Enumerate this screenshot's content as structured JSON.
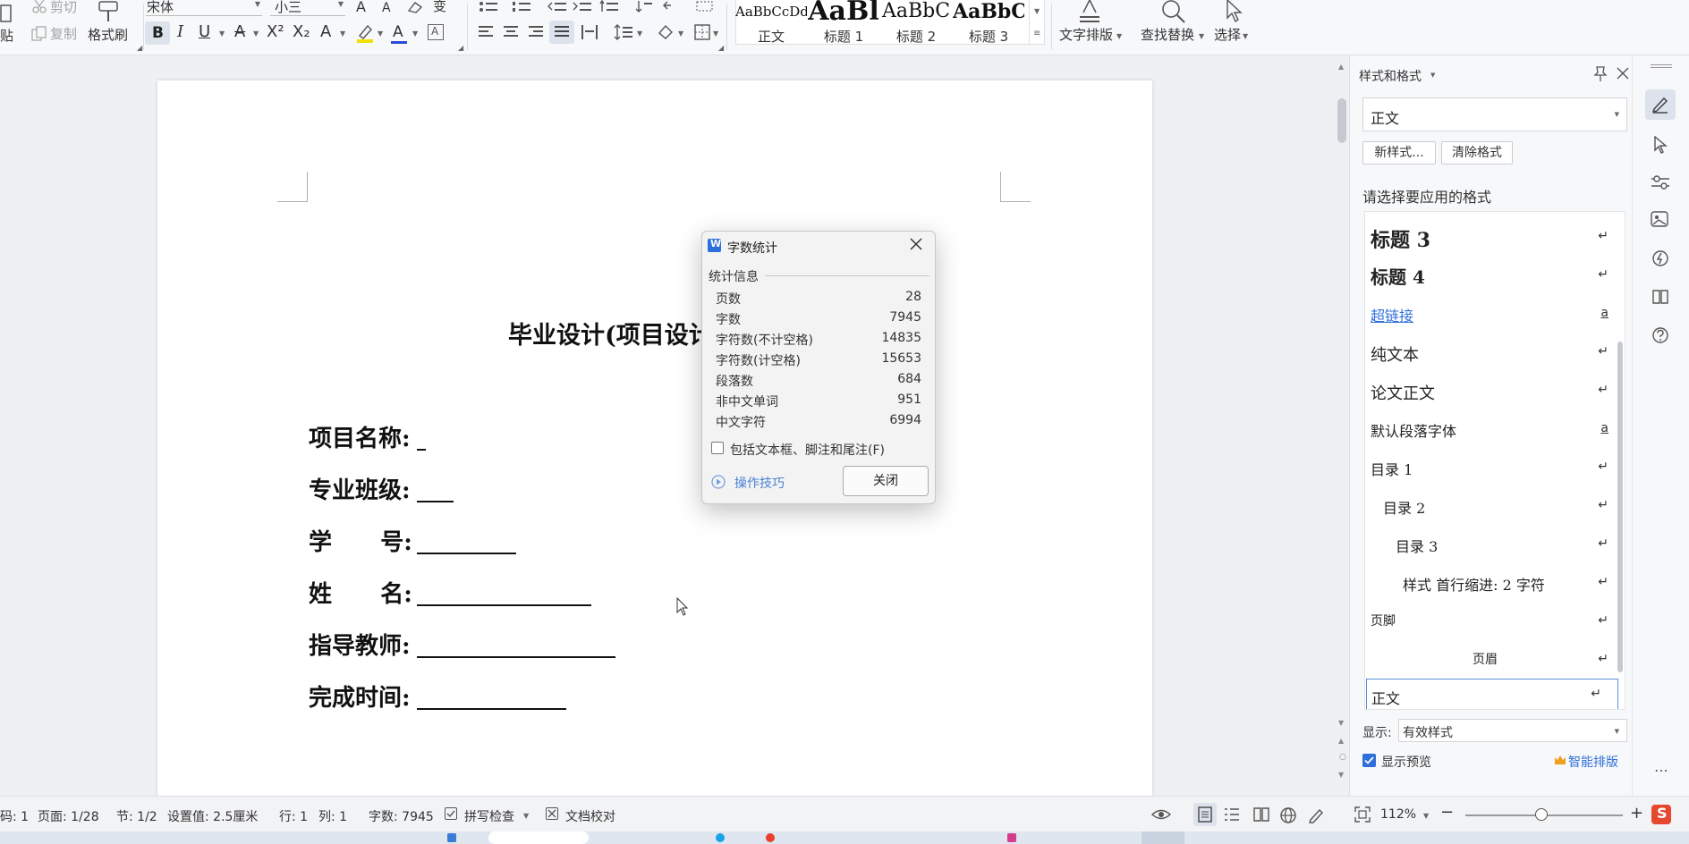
{
  "ribbon": {
    "paste_label": "贴",
    "cut_label": "剪切",
    "copy_label": "复制",
    "format_painter_label": "格式刷",
    "font_name": "宋体",
    "font_size": "小三",
    "styles": [
      {
        "preview": "AaBbCcDd",
        "name": "正文"
      },
      {
        "preview": "AaBl",
        "name": "标题 1"
      },
      {
        "preview": "AaBbC",
        "name": "标题 2"
      },
      {
        "preview": "AaBbC",
        "name": "标题 3"
      }
    ],
    "text_layout_label": "文字排版",
    "find_replace_label": "查找替换",
    "select_label": "选择"
  },
  "document": {
    "title": "毕业设计(项目设计",
    "fields": [
      {
        "label": "项目名称:"
      },
      {
        "label": "专业班级:"
      },
      {
        "label": "学      号:"
      },
      {
        "label": "姓      名:"
      },
      {
        "label": "指导教师:"
      },
      {
        "label": "完成时间:"
      }
    ]
  },
  "dialog": {
    "title": "字数统计",
    "section_label": "统计信息",
    "stats": [
      {
        "label": "页数",
        "value": "28"
      },
      {
        "label": "字数",
        "value": "7945"
      },
      {
        "label": "字符数(不计空格)",
        "value": "14835"
      },
      {
        "label": "字符数(计空格)",
        "value": "15653"
      },
      {
        "label": "段落数",
        "value": "684"
      },
      {
        "label": "非中文单词",
        "value": "951"
      },
      {
        "label": "中文字符",
        "value": "6994"
      }
    ],
    "include_label": "包括文本框、脚注和尾注(F)",
    "tips_label": "操作技巧",
    "close_label": "关闭"
  },
  "panel": {
    "title": "样式和格式",
    "current_style": "正文",
    "new_style_label": "新样式...",
    "clear_format_label": "清除格式",
    "prompt": "请选择要应用的格式",
    "styles": [
      {
        "name": "标题  3",
        "mark": "↵"
      },
      {
        "name": "标题  4",
        "mark": "↵"
      },
      {
        "name": "超链接",
        "mark": "a"
      },
      {
        "name": "纯文本",
        "mark": "↵"
      },
      {
        "name": "论文正文",
        "mark": "↵"
      },
      {
        "name": "默认段落字体",
        "mark": "a"
      },
      {
        "name": "目录 1",
        "mark": "↵"
      },
      {
        "name": "目录 2",
        "mark": "↵"
      },
      {
        "name": "目录 3",
        "mark": "↵"
      },
      {
        "name": "样式  首行缩进:   2  字符",
        "mark": "↵"
      },
      {
        "name": "页脚",
        "mark": "↵"
      },
      {
        "name": "页眉",
        "mark": "↵"
      },
      {
        "name": "正文",
        "mark": "↵"
      }
    ],
    "show_label": "显示:",
    "show_value": "有效样式",
    "preview_label": "显示预览",
    "smart_layout_label": "智能排版"
  },
  "status": {
    "code": "码: 1",
    "page": "页面: 1/28",
    "section": "节: 1/2",
    "setting": "设置值: 2.5厘米",
    "row": "行: 1",
    "col": "列: 1",
    "words": "字数: 7945",
    "spell_check": "拼写检查",
    "proofread": "文档校对",
    "zoom": "112%"
  },
  "colors": {
    "accent": "#2f6fdb",
    "crown": "#f0a020"
  }
}
